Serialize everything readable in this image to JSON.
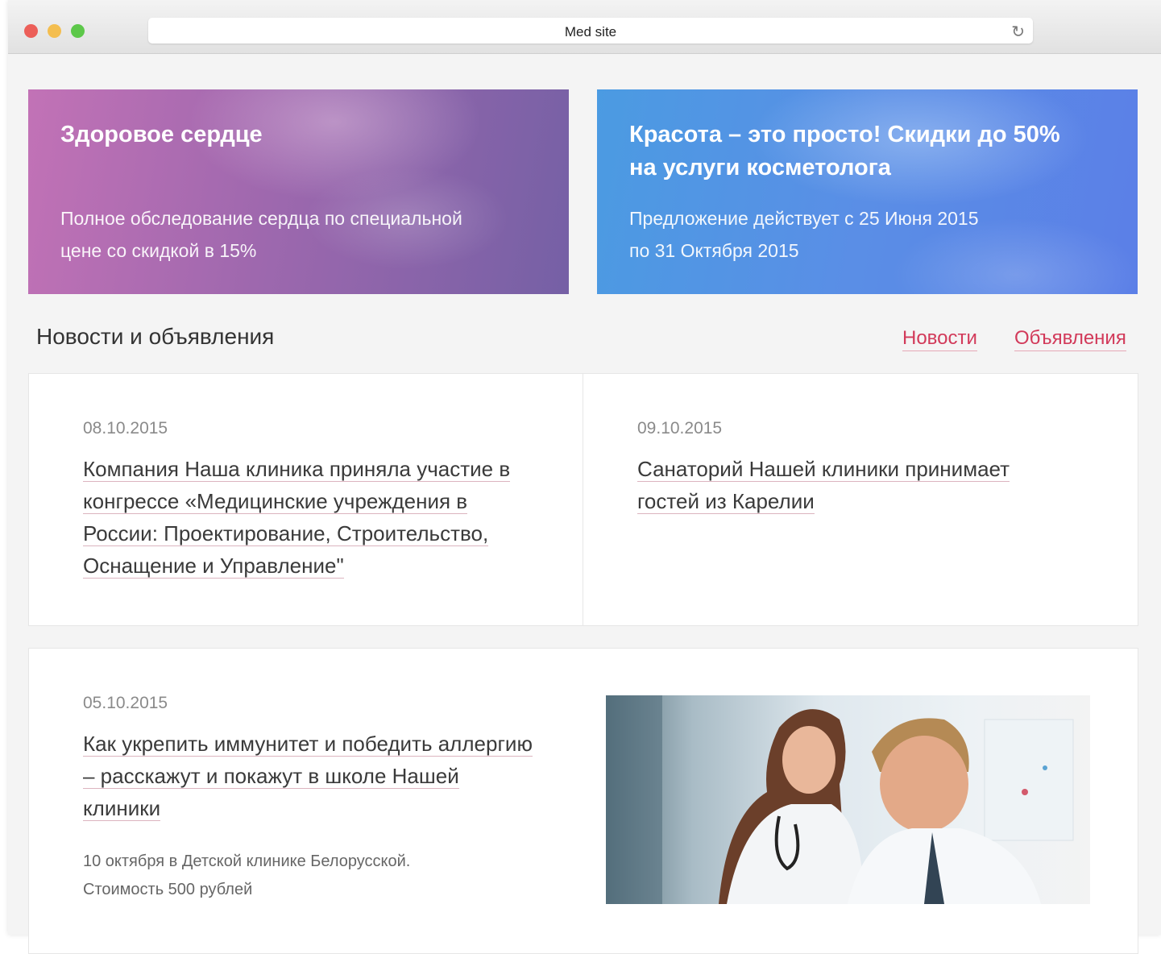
{
  "browser": {
    "url_title": "Med site",
    "reload_icon": "reload-icon"
  },
  "banners": [
    {
      "title": "Здоровое сердце",
      "lines": [
        "Полное обследование сердца по специальной",
        "цене со скидкой в 15%"
      ]
    },
    {
      "title_lines": [
        "Красота – это просто! Скидки до 50%",
        "на услуги косметолога"
      ],
      "lines": [
        "Предложение действует с 25 Июня 2015",
        "по 31 Октября 2015"
      ]
    }
  ],
  "section": {
    "title": "Новости и объявления",
    "tabs": [
      "Новости",
      "Объявления"
    ]
  },
  "news": [
    {
      "date": "08.10.2015",
      "headline_lines": [
        "Компания Наша клиника приняла участие в",
        "конгрессе «Медицинские учреждения в",
        "России: Проектирование, Строительство,",
        "Оснащение и Управление\""
      ]
    },
    {
      "date": "09.10.2015",
      "headline_lines": [
        "Санаторий Нашей клиники принимает",
        "гостей из Карелии"
      ]
    },
    {
      "date": "05.10.2015",
      "headline_lines": [
        "Как укрепить иммунитет и победить аллергию",
        "– расскажут и покажут в школе Нашей",
        "клиники"
      ],
      "note_lines": [
        "10 октября в Детской клинике Белорусской.",
        "Стоимость 500 рублей"
      ]
    }
  ],
  "colors": {
    "accent": "#d23a5a",
    "banner_left": "#9e68ae",
    "banner_right": "#5a8ee6"
  }
}
